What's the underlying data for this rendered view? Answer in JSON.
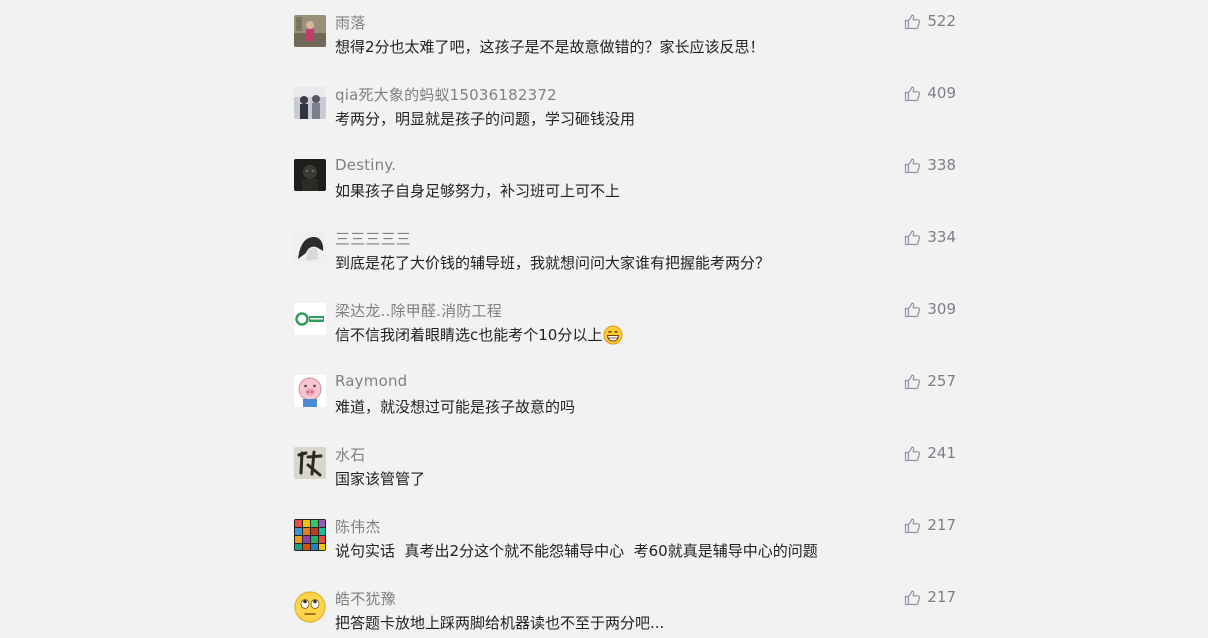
{
  "colors": {
    "background": "#f2f2f2",
    "username": "#808080",
    "comment_text": "#222222",
    "like_count": "#7a7f88",
    "like_icon": "#8a93a5"
  },
  "comments": [
    {
      "user": "雨落",
      "text": "想得2分也太难了吧，这孩子是不是故意做错的？家长应该反思！",
      "likes": "522",
      "avatar_icon": "person-photo-icon"
    },
    {
      "user": "qia死大象的蚂蚁15036182372",
      "text": "考两分，明显就是孩子的问题，学习砸钱没用",
      "likes": "409",
      "avatar_icon": "people-photo-icon"
    },
    {
      "user": "Destiny.",
      "text": "如果孩子自身足够努力，补习班可上可不上",
      "likes": "338",
      "avatar_icon": "dark-portrait-icon"
    },
    {
      "user": "三三三三三",
      "text": "到底是花了大价钱的辅导班，我就想问问大家谁有把握能考两分？",
      "likes": "334",
      "avatar_icon": "sketch-portrait-icon"
    },
    {
      "user": "梁达龙..除甲醛.消防工程",
      "text": "信不信我闭着眼睛选c也能考个10分以上",
      "likes": "309",
      "avatar_icon": "company-logo-icon",
      "emoji": "grinning-face-emoji"
    },
    {
      "user": "Raymond",
      "text": "难道，就没想过可能是孩子故意的吗",
      "likes": "257",
      "avatar_icon": "pig-cartoon-icon"
    },
    {
      "user": "水石",
      "text": "国家该管管了",
      "likes": "241",
      "avatar_icon": "calligraphy-icon"
    },
    {
      "user": "陈伟杰",
      "text": "说句实话  真考出2分这个就不能怨辅导中心  考60就真是辅导中心的问题",
      "likes": "217",
      "avatar_icon": "color-grid-icon"
    },
    {
      "user": "皓不犹豫",
      "text": "把答题卡放地上踩两脚给机器读也不至于两分吧...",
      "likes": "217",
      "avatar_icon": "rolling-eyes-emoji-icon"
    }
  ]
}
